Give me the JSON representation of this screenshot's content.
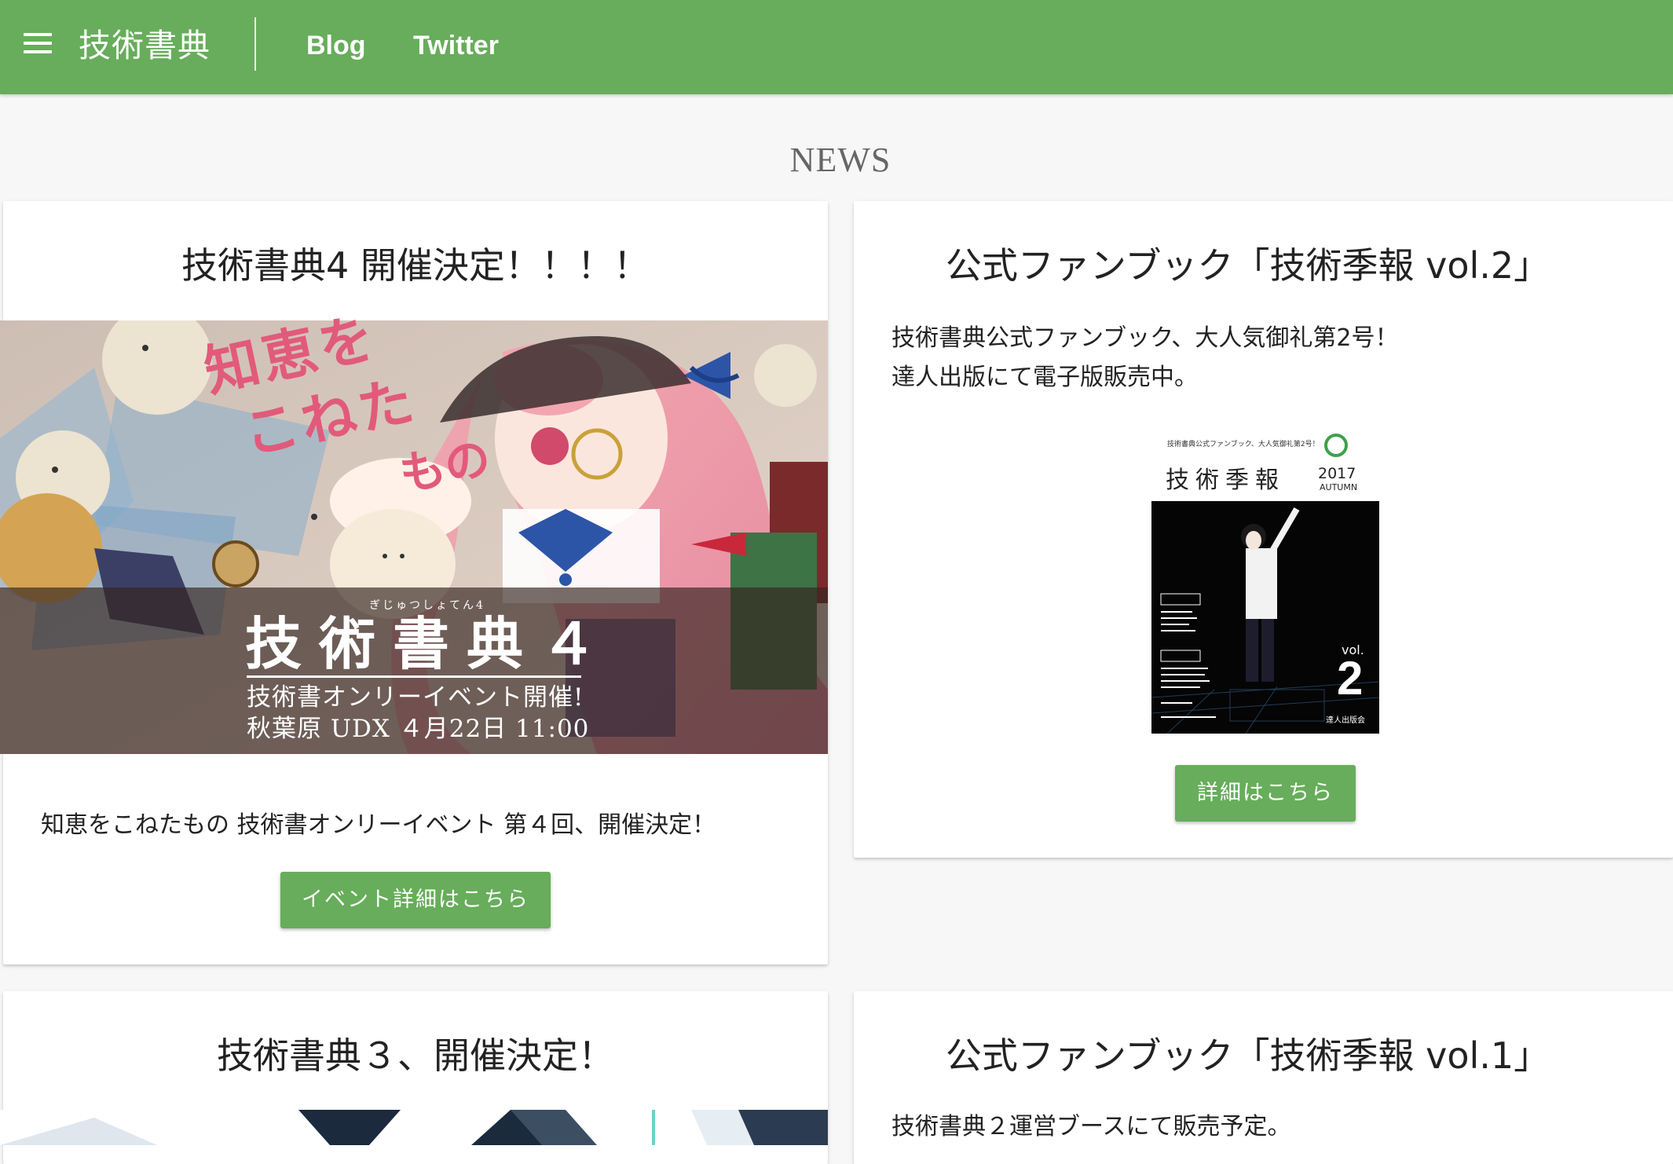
{
  "nav": {
    "brand": "技術書典",
    "links": [
      "Blog",
      "Twitter"
    ]
  },
  "section_title": "NEWS",
  "cards": [
    {
      "title": "技術書典4 開催決定！！！！",
      "banner": {
        "logo_text": [
          "知恵を",
          "こねた",
          "もの"
        ],
        "ruby": "ぎじゅつしょてん4",
        "title": "技術書典４",
        "subtitle": "技術書オンリーイベント開催!",
        "date_line": "秋葉原 UDX  ４月22日  11:00"
      },
      "body": "知恵をこねたもの 技術書オンリーイベント 第４回、開催決定！",
      "button": "イベント詳細はこちら"
    },
    {
      "title": "公式ファンブック「技術季報 vol.2」",
      "body_lines": [
        "技術書典公式ファンブック、大人気御礼第2号！",
        "達人出版にて電子版販売中。"
      ],
      "cover": {
        "header": "技術書典公式ファンブック、大人気御礼第2号！",
        "title": "技術季報",
        "year": "2017",
        "season": "AUTUMN",
        "vol_label": "vol.",
        "vol_number": "2",
        "publisher": "達人出版会"
      },
      "button": "詳細はこちら"
    },
    {
      "title": "技術書典３、開催決定！"
    },
    {
      "title": "公式ファンブック「技術季報 vol.1」",
      "body_lines": [
        "技術書典２運営ブースにて販売予定。"
      ]
    }
  ],
  "colors": {
    "brand_green": "#67ad5b",
    "background": "#f7f7f7"
  }
}
